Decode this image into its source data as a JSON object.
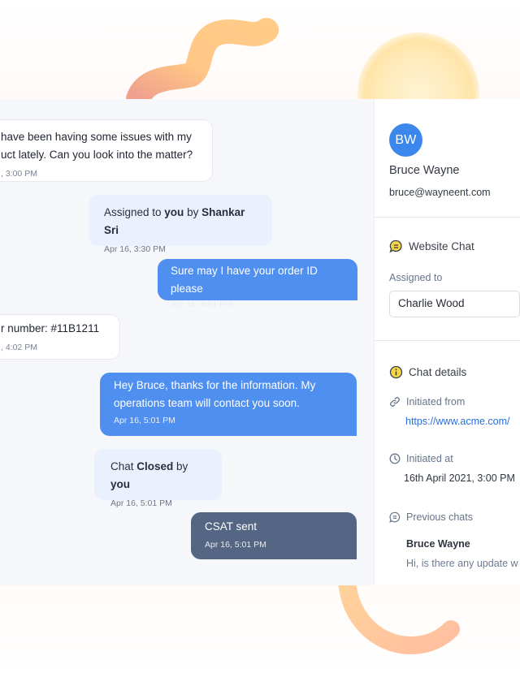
{
  "chat": {
    "messages": [
      {
        "type": "incoming",
        "text_line1": "have been having some issues with my",
        "text_line2": "uct lately. Can you look into the matter?",
        "time": ", 3:00 PM"
      },
      {
        "type": "system",
        "prefix": "Assigned to ",
        "bold1": "you",
        "middle": " by ",
        "bold2": "Shankar Sri",
        "time": "Apr 16, 3:30 PM"
      },
      {
        "type": "outgoing",
        "text": "Sure may I have your order ID please",
        "time": "Apr 16, 4:01 PM"
      },
      {
        "type": "incoming",
        "text": "r number: #11B1211",
        "time": ", 4:02 PM"
      },
      {
        "type": "outgoing",
        "text_line1": "Hey Bruce, thanks for the information. My",
        "text_line2": "operations team will contact you soon.",
        "time": "Apr 16, 5:01 PM"
      },
      {
        "type": "system",
        "prefix": "Chat ",
        "bold1": "Closed",
        "middle": " by ",
        "bold2": "you",
        "time": "Apr 16, 5:01 PM"
      },
      {
        "type": "csat",
        "text": "CSAT sent",
        "time": "Apr 16, 5:01 PM"
      }
    ]
  },
  "contact": {
    "initials": "BW",
    "name": "Bruce Wayne",
    "email": "bruce@wayneent.com"
  },
  "channel": {
    "title": "Website Chat",
    "icon": "chat-bubble-icon",
    "assigned_label": "Assigned to",
    "assigned_value": "Charlie Wood"
  },
  "details": {
    "title": "Chat details",
    "icon": "info-icon",
    "initiated_from_label": "Initiated from",
    "initiated_from_value": "https://www.acme.com/",
    "initiated_at_label": "Initiated at",
    "initiated_at_value": "16th April 2021, 3:00 PM",
    "previous_chats_label": "Previous chats",
    "previous_chat_name": "Bruce Wayne",
    "previous_chat_preview": "Hi, is there any update w"
  },
  "colors": {
    "outgoing_bubble": "#4f8ff0",
    "csat_bubble": "#546683",
    "system_bubble": "#eaf0fd",
    "avatar": "#3c87ec",
    "link": "#2a6fd6",
    "accent_yellow": "#f7d54a"
  }
}
